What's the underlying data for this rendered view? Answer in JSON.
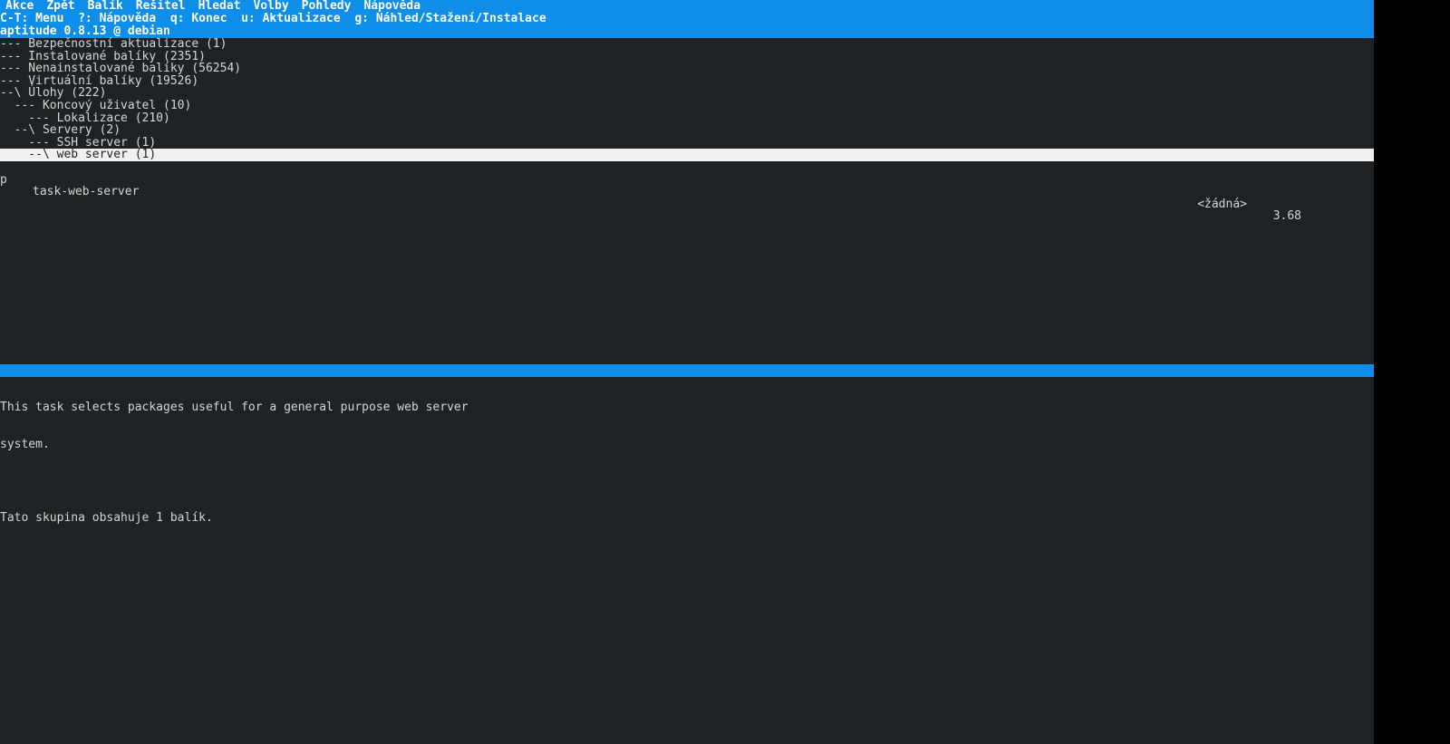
{
  "menubar": {
    "items": [
      "Akce",
      "Zpět",
      "Balík",
      "Řešitel",
      "Hledat",
      "Volby",
      "Pohledy",
      "Nápověda"
    ]
  },
  "hintbar": {
    "text": "C-T: Menu  ?: Nápověda  q: Konec  u: Aktualizace  g: Náhled/Stažení/Instalace"
  },
  "titlebar": {
    "text": "aptitude 0.8.13 @ debian"
  },
  "tree": {
    "rows": [
      "--- Bezpečnostní aktualizace (1)",
      "--- Instalované balíky (2351)",
      "--- Nenainstalované balíky (56254)",
      "--- Virtuální balíky (19526)",
      "--\\ Úlohy (222)",
      "  --- Koncový uživatel (10)",
      "    --- Lokalizace (210)",
      "  --\\ Servery (2)",
      "    --- SSH server (1)",
      "    --\\ web server (1)"
    ],
    "selected_index": 9
  },
  "package_row": {
    "status": "p",
    "name": "task-web-server",
    "available": "<žádná>",
    "version": "3.68"
  },
  "description": {
    "lines": [
      "This task selects packages useful for a general purpose web server",
      "system.",
      "",
      "Tato skupina obsahuje 1 balík."
    ]
  }
}
